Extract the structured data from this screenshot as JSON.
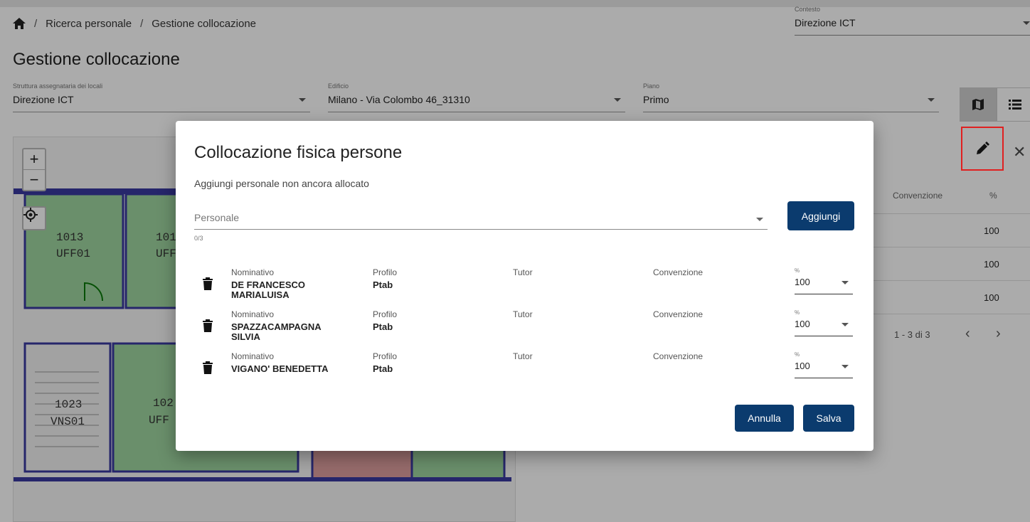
{
  "breadcrumb": {
    "items": [
      "Ricerca personale",
      "Gestione collocazione"
    ],
    "separator": "/"
  },
  "contesto": {
    "label": "Contesto",
    "value": "Direzione ICT"
  },
  "page_title": "Gestione collocazione",
  "filters": {
    "struttura": {
      "label": "Struttura assegnataria dei locali",
      "value": "Direzione ICT"
    },
    "edificio": {
      "label": "Edificio",
      "value": "Milano - Via Colombo 46_31310"
    },
    "piano": {
      "label": "Piano",
      "value": "Primo"
    }
  },
  "background_table": {
    "headers": [
      "Convenzione",
      "%"
    ],
    "rows": [
      {
        "pct": "100"
      },
      {
        "pct": "100"
      },
      {
        "pct": "100"
      }
    ],
    "pager": "1 - 3 di 3"
  },
  "map": {
    "rooms": [
      {
        "number": "1013",
        "code": "UFF01"
      },
      {
        "number": "101",
        "code": "UFF"
      },
      {
        "number": "1023",
        "code": "VNS01"
      },
      {
        "number": "102",
        "code": "UFF"
      }
    ],
    "zoom_in": "+",
    "zoom_out": "−"
  },
  "dialog": {
    "title": "Collocazione fisica persone",
    "subtitle": "Aggiungi personale non ancora allocato",
    "personale_placeholder": "Personale",
    "personale_count": "0/3",
    "add_button": "Aggiungi",
    "cancel_button": "Annulla",
    "save_button": "Salva",
    "column_labels": {
      "nominativo": "Nominativo",
      "profilo": "Profilo",
      "tutor": "Tutor",
      "convenzione": "Convenzione",
      "percent": "%"
    },
    "rows": [
      {
        "nominativo": "DE FRANCESCO MARIALUISA",
        "profilo": "Ptab",
        "percent": "100"
      },
      {
        "nominativo": "SPAZZACAMPAGNA SILVIA",
        "profilo": "Ptab",
        "percent": "100"
      },
      {
        "nominativo": "VIGANO' BENEDETTA",
        "profilo": "Ptab",
        "percent": "100"
      }
    ]
  },
  "colors": {
    "primary": "#0b3b6e",
    "highlight": "#e02020",
    "room_fill": "#9fd5a0",
    "wall": "#3a3aa0"
  }
}
